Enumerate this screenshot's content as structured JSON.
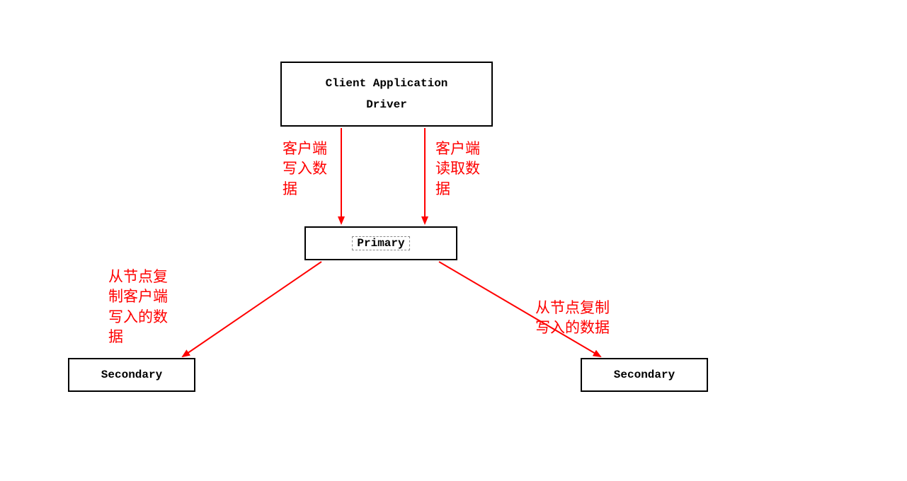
{
  "nodes": {
    "client": {
      "line1": "Client Application",
      "line2": "Driver"
    },
    "primary": "Primary",
    "secondary_left": "Secondary",
    "secondary_right": "Secondary"
  },
  "edges": {
    "client_write": "客户端写入数据",
    "client_read": "客户端读取数据",
    "replicate_left": "从节点复制客户端写入的数据",
    "replicate_right": "从节点复制写入的数据"
  },
  "colors": {
    "arrow": "#ff0000",
    "box_border": "#000000",
    "background": "#ffffff"
  }
}
